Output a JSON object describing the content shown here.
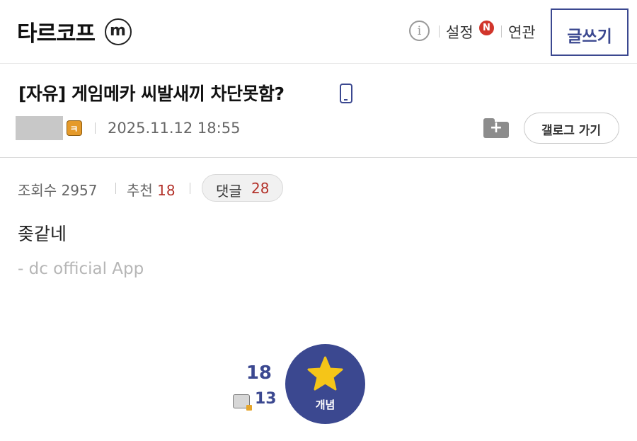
{
  "header": {
    "gallery_name": "타르코프",
    "minor_badge": "m",
    "info_icon": "i",
    "settings_label": "설정",
    "new_badge": "N",
    "related_label": "연관",
    "write_label": "글쓰기"
  },
  "post": {
    "title": "[자유] 게임메카 씨발새끼 차단못함?",
    "fix_icon": "ㅋ",
    "date": "2025.11.12 18:55",
    "folder_plus": "+",
    "gallog_label": "갤로그 가기",
    "views_label": "조회수",
    "views": "2957",
    "recommend_label": "추천",
    "recommend": "18",
    "comments_label": "댓글",
    "comments": "28",
    "content": "좆같네",
    "signature": "- dc official App"
  },
  "recommend_box": {
    "count": "18",
    "fix_count": "13",
    "button_label": "개념"
  },
  "colors": {
    "accent": "#3b4890",
    "red": "#b3322a",
    "star": "#f5c518"
  },
  "icons": [
    "minor-gallery-icon",
    "info-icon",
    "new-badge",
    "phone-icon",
    "fixed-nick-icon",
    "folder-add-icon",
    "star-icon"
  ]
}
